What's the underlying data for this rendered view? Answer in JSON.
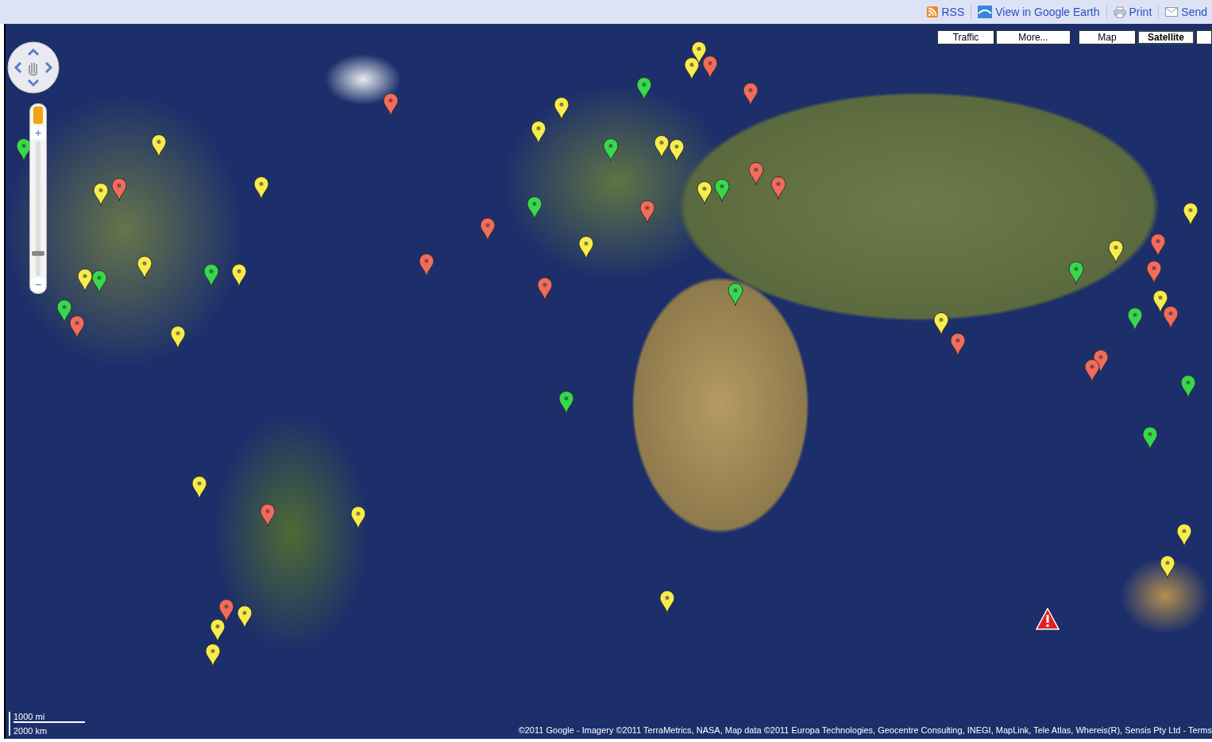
{
  "toolbar": {
    "links": [
      {
        "kind": "rss",
        "label": "RSS"
      },
      {
        "kind": "earth",
        "label": "View in Google Earth"
      },
      {
        "kind": "print",
        "label": "Print"
      },
      {
        "kind": "send",
        "label": "Send"
      }
    ]
  },
  "map": {
    "type_buttons": [
      {
        "label": "Traffic",
        "selected": false
      },
      {
        "label": "More...",
        "selected": false
      },
      {
        "label": "Map",
        "selected": false
      },
      {
        "label": "Satellite",
        "selected": true
      }
    ],
    "markers": [
      {
        "color": "#f26b5b"
      },
      {
        "color": "#f26b5b"
      },
      {
        "color": "#f26b5b"
      },
      {
        "color": "#f26b5b"
      },
      {
        "color": "#f26b5b"
      },
      {
        "color": "#f26b5b"
      },
      {
        "color": "#f26b5b"
      },
      {
        "color": "#f26b5b"
      },
      {
        "color": "#f26b5b"
      },
      {
        "color": "#f26b5b"
      },
      {
        "color": "#f26b5b"
      },
      {
        "color": "#f26b5b"
      },
      {
        "color": "#f26b5b"
      },
      {
        "color": "#f26b5b"
      },
      {
        "color": "#f26b5b"
      },
      {
        "color": "#f26b5b"
      },
      {
        "color": "#f26b5b"
      },
      {
        "color": "#f26b5b"
      },
      {
        "color": "#f26b5b"
      },
      {
        "color": "#f7ec4c"
      },
      {
        "color": "#f7ec4c"
      },
      {
        "color": "#f7ec4c"
      },
      {
        "color": "#f7ec4c"
      },
      {
        "color": "#f7ec4c"
      },
      {
        "color": "#f7ec4c"
      },
      {
        "color": "#f7ec4c"
      },
      {
        "color": "#f7ec4c"
      },
      {
        "color": "#f7ec4c"
      },
      {
        "color": "#f7ec4c"
      },
      {
        "color": "#f7ec4c"
      },
      {
        "color": "#f7ec4c"
      },
      {
        "color": "#f7ec4c"
      },
      {
        "color": "#f7ec4c"
      },
      {
        "color": "#f7ec4c"
      },
      {
        "color": "#f7ec4c"
      },
      {
        "color": "#f7ec4c"
      },
      {
        "color": "#f7ec4c"
      },
      {
        "color": "#f7ec4c"
      },
      {
        "color": "#f7ec4c"
      },
      {
        "color": "#f7ec4c"
      },
      {
        "color": "#f7ec4c"
      },
      {
        "color": "#f7ec4c"
      },
      {
        "color": "#f7ec4c"
      },
      {
        "color": "#f7ec4c"
      },
      {
        "color": "#f7ec4c"
      },
      {
        "color": "#f7ec4c"
      },
      {
        "color": "#36d94c"
      },
      {
        "color": "#36d94c"
      },
      {
        "color": "#36d94c"
      },
      {
        "color": "#36d94c"
      },
      {
        "color": "#36d94c"
      },
      {
        "color": "#36d94c"
      },
      {
        "color": "#36d94c"
      },
      {
        "color": "#36d94c"
      },
      {
        "color": "#36d94c"
      },
      {
        "color": "#36d94c"
      },
      {
        "color": "#36d94c"
      },
      {
        "color": "#36d94c"
      },
      {
        "color": "#36d94c"
      },
      {
        "color": "#36d94c"
      }
    ],
    "zoom": {
      "in": "+",
      "out": "−",
      "level": 0.15
    },
    "scale": [
      "1000 mi",
      "2000 km"
    ],
    "copyright": "©2011 Google - Imagery ©2011 TerraMetrics, NASA, Map data ©2011 Europa Technologies, Geocentre Consulting, INEGI, MapLink, Tele Atlas, Whereis(R), Sensis Pty Ltd - Terms"
  }
}
